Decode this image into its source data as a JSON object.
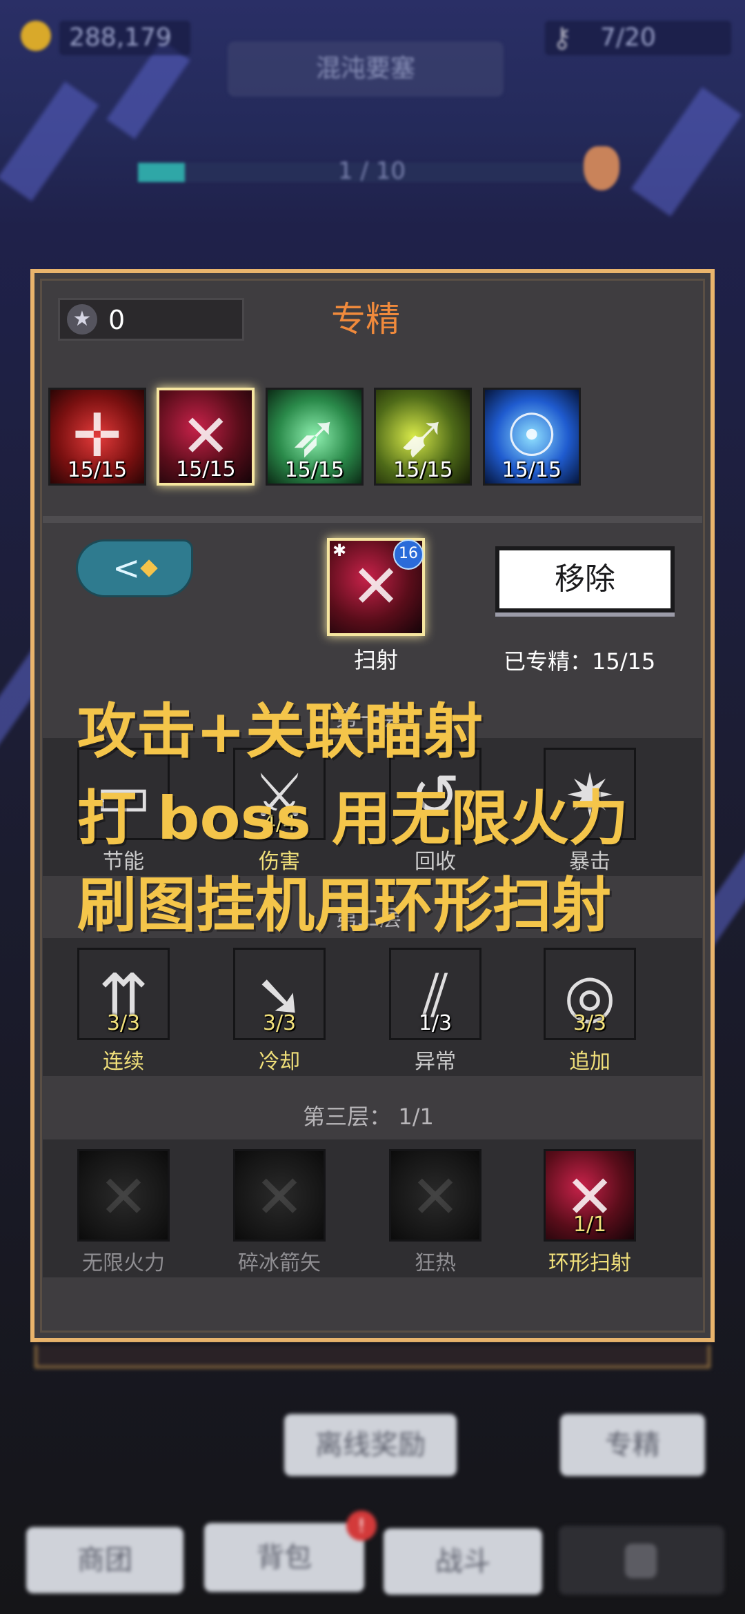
{
  "hud": {
    "gold_value": "288,179",
    "key_value": "7/20",
    "stage_name": "混沌要塞",
    "stage_progress_text": "1 / 10",
    "stage_progress_fraction": 0.1,
    "icons": {
      "gold": "coin-icon",
      "key": "key-icon",
      "boss": "boss-mask-icon"
    }
  },
  "panel": {
    "title": "专精",
    "points_value": "0",
    "points_icon": "star-medal-icon",
    "skills": [
      {
        "level": "15/15",
        "icon": "crosshair-skill-icon",
        "art": "red",
        "selected": false
      },
      {
        "level": "15/15",
        "icon": "crossbow-skill-icon",
        "art": "crimson",
        "selected": true
      },
      {
        "level": "15/15",
        "icon": "triple-arrow-bow-icon",
        "art": "green",
        "selected": false
      },
      {
        "level": "15/15",
        "icon": "arrow-bow-icon",
        "art": "lime",
        "selected": false
      },
      {
        "level": "15/15",
        "icon": "spirit-figure-icon",
        "art": "blue",
        "selected": false
      }
    ],
    "selected_skill": {
      "name": "扫射",
      "badge": "16",
      "icon": "crossbow-skill-icon"
    },
    "remove_label": "移除",
    "spec_status": "已专精：15/15",
    "back_icon": "back-arrow-icon"
  },
  "tiers": [
    {
      "title": "第一层",
      "talents": [
        {
          "name": "节能",
          "count": "",
          "icon": "book-icon",
          "state": "normal"
        },
        {
          "name": "伤害",
          "count": "4/4",
          "icon": "sword-slash-icon",
          "state": "active"
        },
        {
          "name": "回收",
          "count": "",
          "icon": "recycle-icon",
          "state": "normal"
        },
        {
          "name": "暴击",
          "count": "",
          "icon": "burst-arrows-icon",
          "state": "normal"
        }
      ]
    },
    {
      "title": "第二层",
      "talents": [
        {
          "name": "连续",
          "count": "3/3",
          "icon": "multi-arrow-icon",
          "state": "active"
        },
        {
          "name": "冷却",
          "count": "3/3",
          "icon": "cooldown-arrow-icon",
          "state": "active"
        },
        {
          "name": "异常",
          "count": "1/3",
          "icon": "claw-slash-icon",
          "state": "normal"
        },
        {
          "name": "追加",
          "count": "3/3",
          "icon": "target-strike-icon",
          "state": "active"
        }
      ]
    },
    {
      "title": "第三层：  1/1",
      "talents": [
        {
          "name": "无限火力",
          "count": "",
          "icon": "crossbow-dark-icon",
          "state": "dim"
        },
        {
          "name": "碎冰箭矢",
          "count": "",
          "icon": "crossbow-dark-icon",
          "state": "dim"
        },
        {
          "name": "狂热",
          "count": "",
          "icon": "crossbow-dark-icon",
          "state": "dim"
        },
        {
          "name": "环形扫射",
          "count": "1/1",
          "icon": "crossbow-skill-icon",
          "state": "active"
        }
      ]
    }
  ],
  "overlay": {
    "line1": "攻击+关联瞄射",
    "line2": "打 boss 用无限火力",
    "line3": "刷图挂机用环形扫射"
  },
  "bottom": {
    "offline_reward": "离线奖励",
    "specialize": "专精",
    "nav": [
      "商团",
      "背包",
      "战斗",
      ""
    ],
    "notification": "!",
    "lock_icon": "lock-icon"
  },
  "colors": {
    "panel_border": "#e9b46c",
    "title": "#f08a3c",
    "overlay_text": "#f4c54a",
    "active_label": "#f1e07a"
  }
}
